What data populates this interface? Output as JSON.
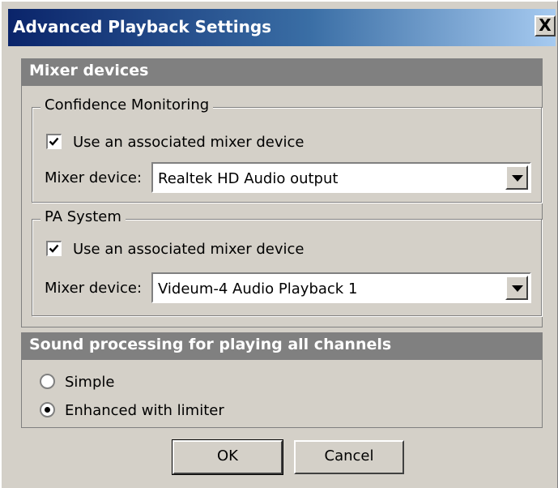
{
  "window": {
    "title": "Advanced Playback Settings",
    "close_glyph": "X",
    "background": "#d4d0c8",
    "titlebar_color_start": "#0a246a",
    "titlebar_color_end": "#a6caf0"
  },
  "mixer_section": {
    "heading": "Mixer devices",
    "confidence": {
      "legend": "Confidence Monitoring",
      "checkbox_label": "Use an associated mixer device",
      "checked": true,
      "device_label": "Mixer device:",
      "device_value": "Realtek HD Audio output"
    },
    "pa": {
      "legend": "PA System",
      "checkbox_label": "Use an associated mixer device",
      "checked": true,
      "device_label": "Mixer device:",
      "device_value": "Videum-4 Audio Playback 1"
    }
  },
  "sound_section": {
    "heading": "Sound processing for playing all channels",
    "options": [
      {
        "label": "Simple",
        "selected": false
      },
      {
        "label": "Enhanced with limiter",
        "selected": true
      }
    ]
  },
  "buttons": {
    "ok": "OK",
    "cancel": "Cancel"
  }
}
